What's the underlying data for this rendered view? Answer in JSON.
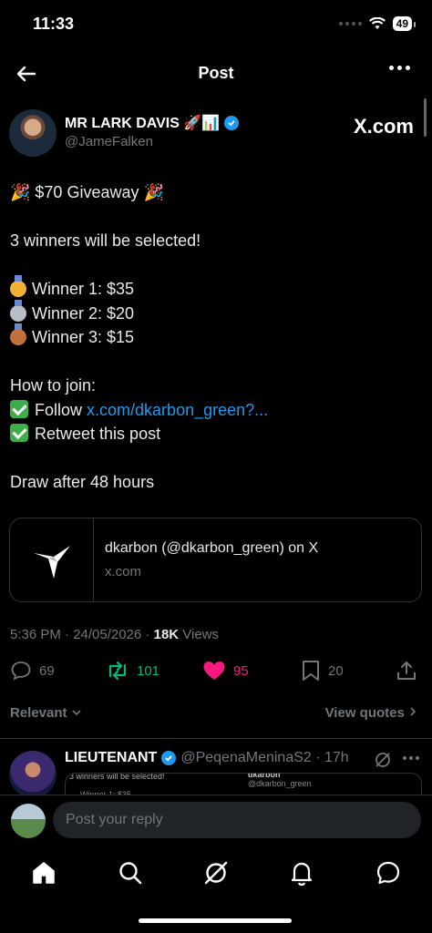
{
  "status_bar": {
    "time": "11:33",
    "battery": "49"
  },
  "header": {
    "title": "Post"
  },
  "author": {
    "name": "MR LARK DAVIS 🚀📊",
    "handle": "@JameFalken",
    "watermark": "X.com"
  },
  "tweet": {
    "headline": "🎉 $70 Giveaway 🎉",
    "winners_line": "3 winners will be selected!",
    "winner1": "Winner 1: $35",
    "winner2": "Winner 2: $20",
    "winner3": "Winner 3: $15",
    "how_to": "How to join:",
    "step1_prefix": "Follow ",
    "step1_link": "x.com/dkarbon_green?...",
    "step2": "Retweet this post",
    "draw": "Draw after 48 hours"
  },
  "card": {
    "title": "dkarbon (@dkarbon_green) on X",
    "domain": "x.com"
  },
  "meta": {
    "time": "5:36 PM · 24/05/2026 · ",
    "views": "18K",
    "views_label": " Views"
  },
  "actions": {
    "replies": "69",
    "retweets": "101",
    "likes": "95",
    "bookmarks": "20"
  },
  "sort": {
    "label": "Relevant",
    "view_quotes": "View quotes"
  },
  "reply": {
    "name": "LIEUTENANT",
    "handle": "@PeqenaMeninaS2 · 17h",
    "quote_line1": "3 winners will be selected!",
    "quote_line2": "dkarbon",
    "quote_line3": "@dkarbon_green",
    "quote_line4": "Winner 1: $35"
  },
  "composer": {
    "placeholder": "Post your reply"
  },
  "colors": {
    "accent": "#1d9bf0",
    "retweet": "#00ba7c",
    "like": "#f91880",
    "muted": "#71767b"
  }
}
